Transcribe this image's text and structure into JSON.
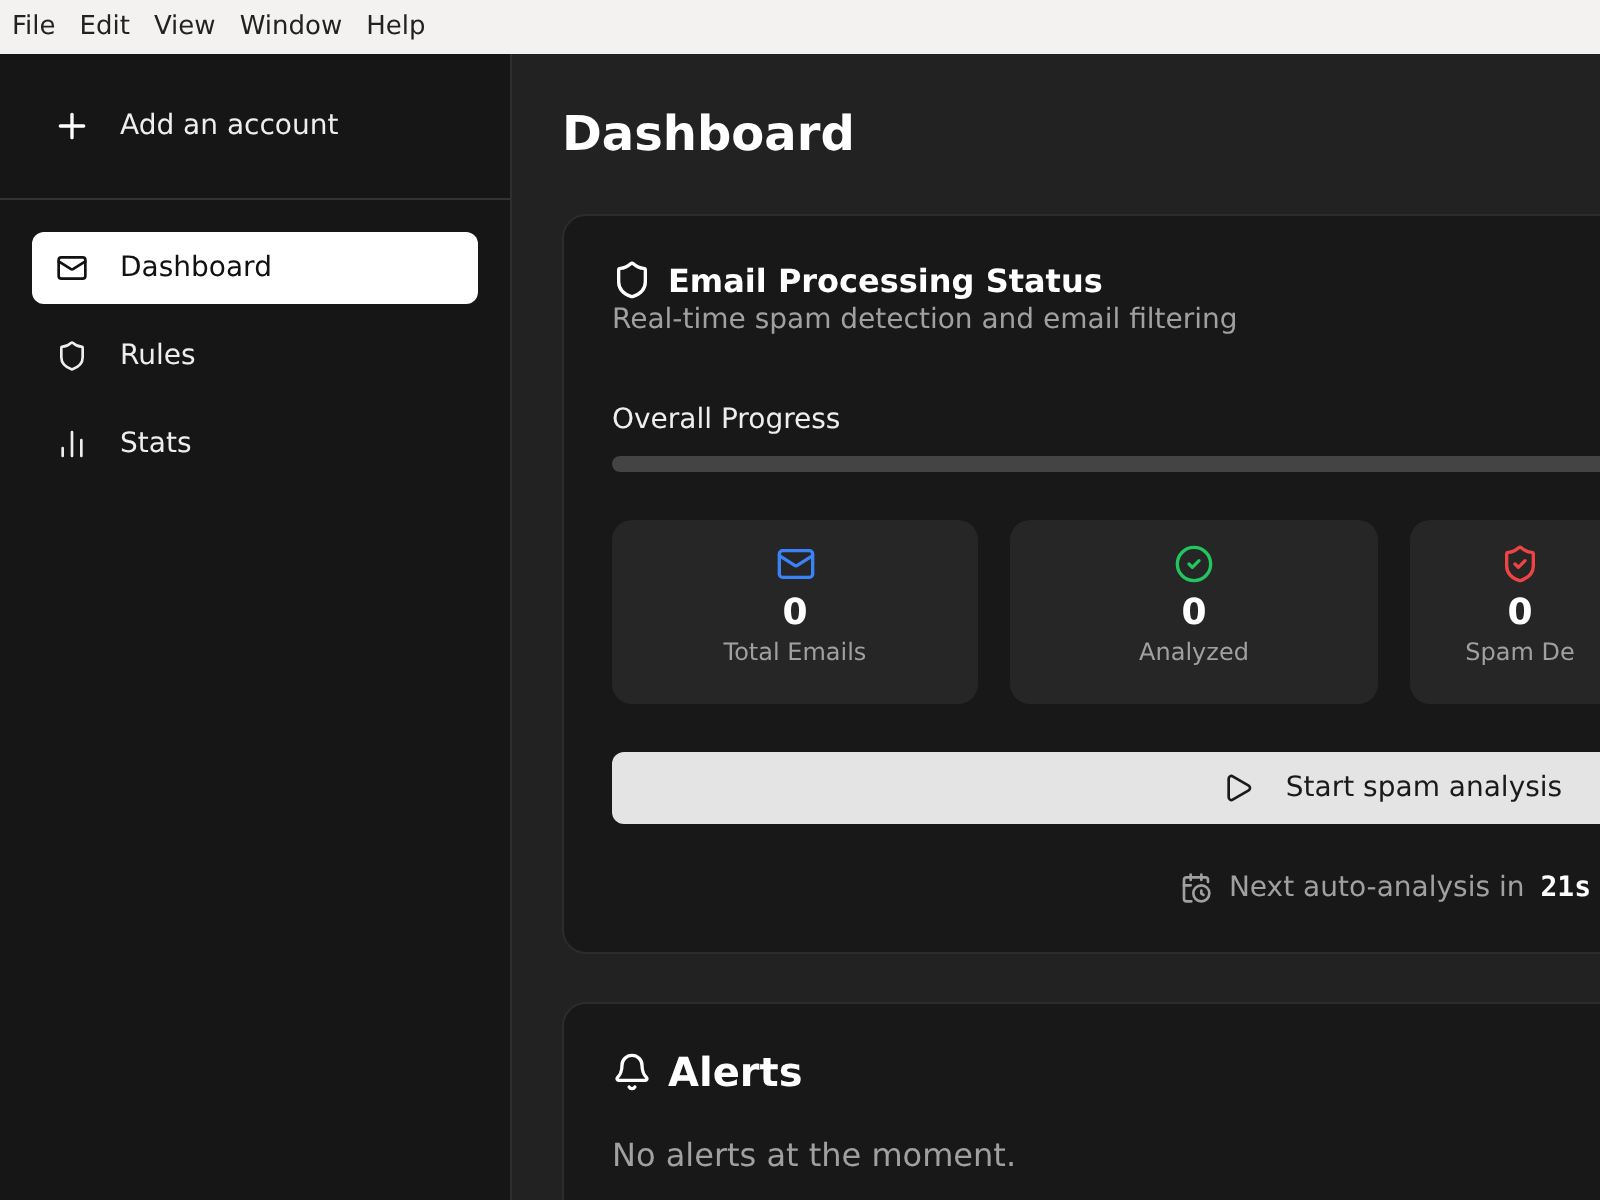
{
  "menu_bar": [
    "File",
    "Edit",
    "View",
    "Window",
    "Help"
  ],
  "sidebar": {
    "add_account": "Add an account",
    "items": [
      {
        "kind": "mail",
        "label": "Dashboard",
        "selected": true
      },
      {
        "kind": "shield",
        "label": "Rules",
        "selected": false
      },
      {
        "kind": "stats",
        "label": "Stats",
        "selected": false
      }
    ]
  },
  "page_title": "Dashboard",
  "status_card": {
    "title": "Email Processing Status",
    "subtitle": "Real-time spam detection and email filtering",
    "progress_label": "Overall Progress",
    "level": 0,
    "stats": [
      {
        "kind": "mail",
        "value": "0",
        "label": "Total Emails",
        "color": "#3b82f6"
      },
      {
        "kind": "check",
        "value": "0",
        "label": "Analyzed",
        "color": "#22c55e"
      },
      {
        "kind": "spam",
        "value": "0",
        "label": "Spam De",
        "color": "#ef4444"
      }
    ],
    "button": "Start spam analysis",
    "next_label": "Next auto-analysis in",
    "next_time": "21s"
  },
  "alerts": {
    "title": "Alerts",
    "empty": "No alerts at the moment."
  }
}
